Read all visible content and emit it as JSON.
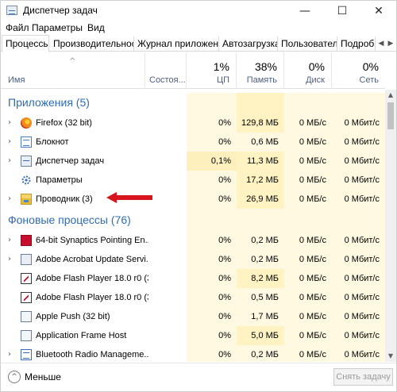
{
  "window": {
    "title": "Диспетчер задач",
    "controls": {
      "minimize": "—",
      "maximize": "☐",
      "close": "✕"
    }
  },
  "menu": [
    "Файл",
    "Параметры",
    "Вид"
  ],
  "tabs": [
    "Процессы",
    "Производительность",
    "Журнал приложений",
    "Автозагрузка",
    "Пользователи",
    "Подробн"
  ],
  "tab_scroll": {
    "left": "◀",
    "right": "▶"
  },
  "columns": {
    "name": {
      "label": "Имя",
      "sort": "^"
    },
    "status": {
      "label": "Состоя..."
    },
    "cpu": {
      "pct": "1%",
      "label": "ЦП"
    },
    "memory": {
      "pct": "38%",
      "label": "Память"
    },
    "disk": {
      "pct": "0%",
      "label": "Диск"
    },
    "network": {
      "pct": "0%",
      "label": "Сеть"
    }
  },
  "sections": {
    "apps": "Приложения (5)",
    "background": "Фоновые процессы (76)"
  },
  "apps": [
    {
      "name": "Firefox (32 bit)",
      "cpu": "0%",
      "mem": "129,8 МБ",
      "disk": "0 МБ/с",
      "net": "0 Мбит/с",
      "icon": "firefox-icon"
    },
    {
      "name": "Блокнот",
      "cpu": "0%",
      "mem": "0,6 МБ",
      "disk": "0 МБ/с",
      "net": "0 Мбит/с",
      "icon": "notepad-icon"
    },
    {
      "name": "Диспетчер задач",
      "cpu": "0,1%",
      "mem": "11,3 МБ",
      "disk": "0 МБ/с",
      "net": "0 Мбит/с",
      "icon": "task-manager-icon"
    },
    {
      "name": "Параметры",
      "cpu": "0%",
      "mem": "17,2 МБ",
      "disk": "0 МБ/с",
      "net": "0 Мбит/с",
      "icon": "settings-gear-icon"
    },
    {
      "name": "Проводник (3)",
      "cpu": "0%",
      "mem": "26,9 МБ",
      "disk": "0 МБ/с",
      "net": "0 Мбит/с",
      "icon": "explorer-folder-icon"
    }
  ],
  "background": [
    {
      "name": "64-bit Synaptics Pointing En...",
      "cpu": "0%",
      "mem": "0,2 МБ",
      "disk": "0 МБ/с",
      "net": "0 Мбит/с",
      "icon": "synaptics-icon"
    },
    {
      "name": "Adobe Acrobat Update Servi...",
      "cpu": "0%",
      "mem": "0,2 МБ",
      "disk": "0 МБ/с",
      "net": "0 Мбит/с",
      "icon": "service-window-icon"
    },
    {
      "name": "Adobe Flash Player 18.0 r0 (3...",
      "cpu": "0%",
      "mem": "8,2 МБ",
      "disk": "0 МБ/с",
      "net": "0 Мбит/с",
      "icon": "flash-player-icon"
    },
    {
      "name": "Adobe Flash Player 18.0 r0 (3...",
      "cpu": "0%",
      "mem": "0,5 МБ",
      "disk": "0 МБ/с",
      "net": "0 Мбит/с",
      "icon": "flash-player-icon"
    },
    {
      "name": "Apple Push (32 bit)",
      "cpu": "0%",
      "mem": "1,7 МБ",
      "disk": "0 МБ/с",
      "net": "0 Мбит/с",
      "icon": "service-window-icon"
    },
    {
      "name": "Application Frame Host",
      "cpu": "0%",
      "mem": "5,0 МБ",
      "disk": "0 МБ/с",
      "net": "0 Мбит/с",
      "icon": "service-window-icon"
    },
    {
      "name": "Bluetooth Radio Manageme...",
      "cpu": "0%",
      "mem": "0,2 МБ",
      "disk": "0 МБ/с",
      "net": "0 Мбит/с",
      "icon": "bluetooth-icon"
    }
  ],
  "footer": {
    "less_icon": "^",
    "less_label": "Меньше",
    "end_task": "Снять задачу"
  },
  "scroll": {
    "up": "▲",
    "down": "▼"
  },
  "colors": {
    "section_title": "#2f6cb3",
    "cpu_bg": "#fff9e2",
    "value_bg": "#fff3c4",
    "arrow": "#d8141c"
  }
}
